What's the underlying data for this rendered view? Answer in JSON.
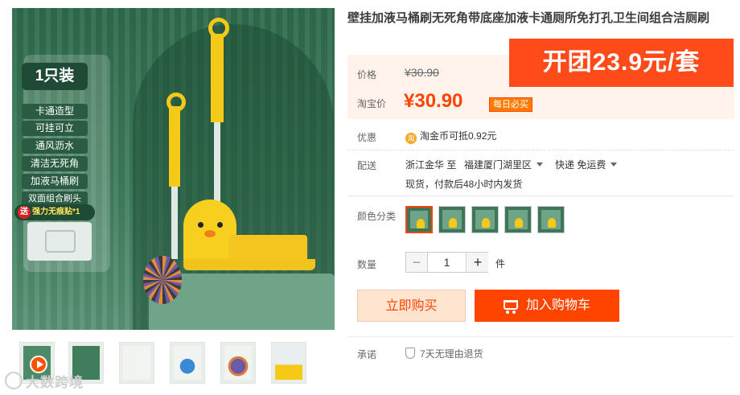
{
  "product": {
    "title": "壁挂加液马桶刷无死角带底座加液卡通厕所免打孔卫生间组合洁厕刷",
    "main_image": {
      "badge": "1只装",
      "features": [
        "卡通造型",
        "可挂可立",
        "通风沥水",
        "清洁无死角",
        "加液马桶刷",
        "双面组合刷头"
      ],
      "gift": {
        "tag": "送",
        "text": "强力无痕贴*1"
      }
    },
    "thumbnails": 6
  },
  "promo_banner": "开团23.9元/套",
  "price": {
    "label": "价格",
    "original": "¥30.90",
    "taobao_label": "淘宝价",
    "current": "¥30.90",
    "daily_badge": "每日必买"
  },
  "discount": {
    "label": "优惠",
    "coin_icon": "淘",
    "text": "淘金币可抵",
    "amount": "0.92元"
  },
  "delivery": {
    "label": "配送",
    "from": "浙江金华",
    "to_word": "至",
    "destination": "福建厦门湖里区",
    "shipping": "快递 免运费",
    "note": "现货，付款后48小时内发货"
  },
  "color": {
    "label": "颜色分类",
    "options": 5,
    "selected_index": 0
  },
  "quantity": {
    "label": "数量",
    "value": "1",
    "minus": "−",
    "plus": "+",
    "unit": "件"
  },
  "actions": {
    "buy_now": "立即购买",
    "add_to_cart": "加入购物车"
  },
  "promise": {
    "label": "承诺",
    "text": "7天无理由退货"
  },
  "watermark": "大数跨境",
  "colors": {
    "accent": "#ff4400",
    "promo": "#ff4a1a",
    "price_bg": "#fff3eb"
  }
}
